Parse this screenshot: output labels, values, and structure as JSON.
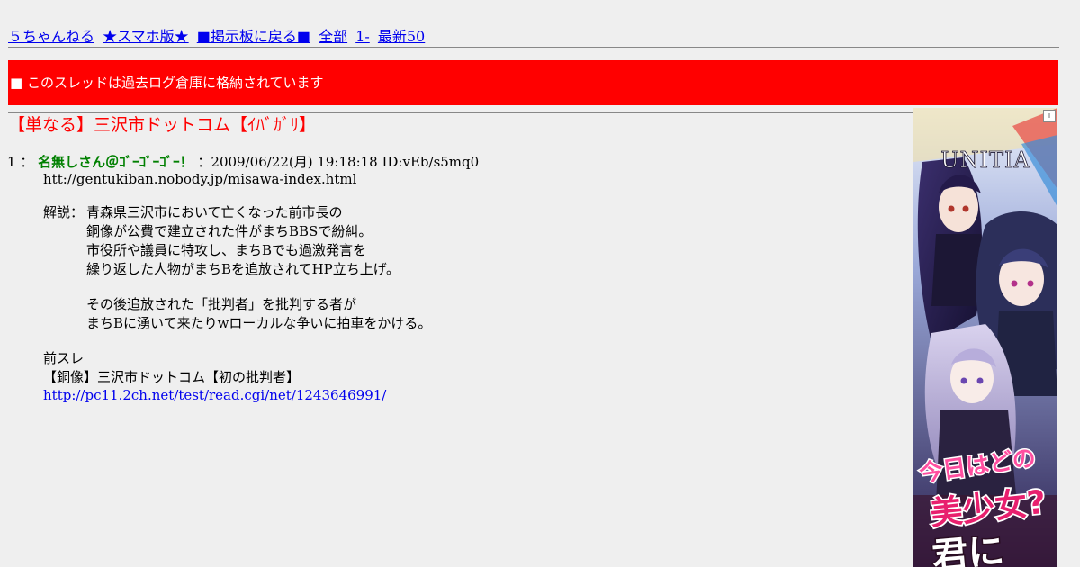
{
  "nav": {
    "site": "５ちゃんねる",
    "smartphone": "★スマホ版★",
    "board_back": "■掲示板に戻る■",
    "all": "全部",
    "first": "1-",
    "latest": "最新50"
  },
  "banner": {
    "text": "■ このスレッドは過去ログ倉庫に格納されています"
  },
  "thread": {
    "title": "【単なる】三沢市ドットコム【ｲﾊﾞｶﾞﾘ】"
  },
  "post": {
    "number": "1",
    "separator": "：",
    "name": "名無しさん＠ｺﾞｰｺﾞｰｺﾞｰ！",
    "meta": "：2009/06/22(月) 19:18:18 ID:vEb/s5mq0",
    "url_line": "htt://gentukiban.nobody.jp/misawa-index.html",
    "commentary_label": "解説：",
    "commentary": [
      "青森県三沢市において亡くなった前市長の",
      "銅像が公費で建立された件がまちBBSで紛糾。",
      "市役所や議員に特攻し、まちBでも過激発言を",
      "繰り返した人物がまちBを追放されてHP立ち上げ。"
    ],
    "followup": [
      "その後追放された「批判者」を批判する者が",
      "まちBに湧いて来たりwローカルな争いに拍車をかける。"
    ],
    "prev_label": "前スレ",
    "prev_title": "【銅像】三沢市ドットコム【初の批判者】",
    "prev_link": "http://pc11.2ch.net/test/read.cgi/net/1243646991/"
  },
  "ad": {
    "brand": "UNITIA",
    "tagline_1": "今日はどの",
    "tagline_2": "美少女?",
    "tagline_3": "君に",
    "info_icon": "i"
  }
}
